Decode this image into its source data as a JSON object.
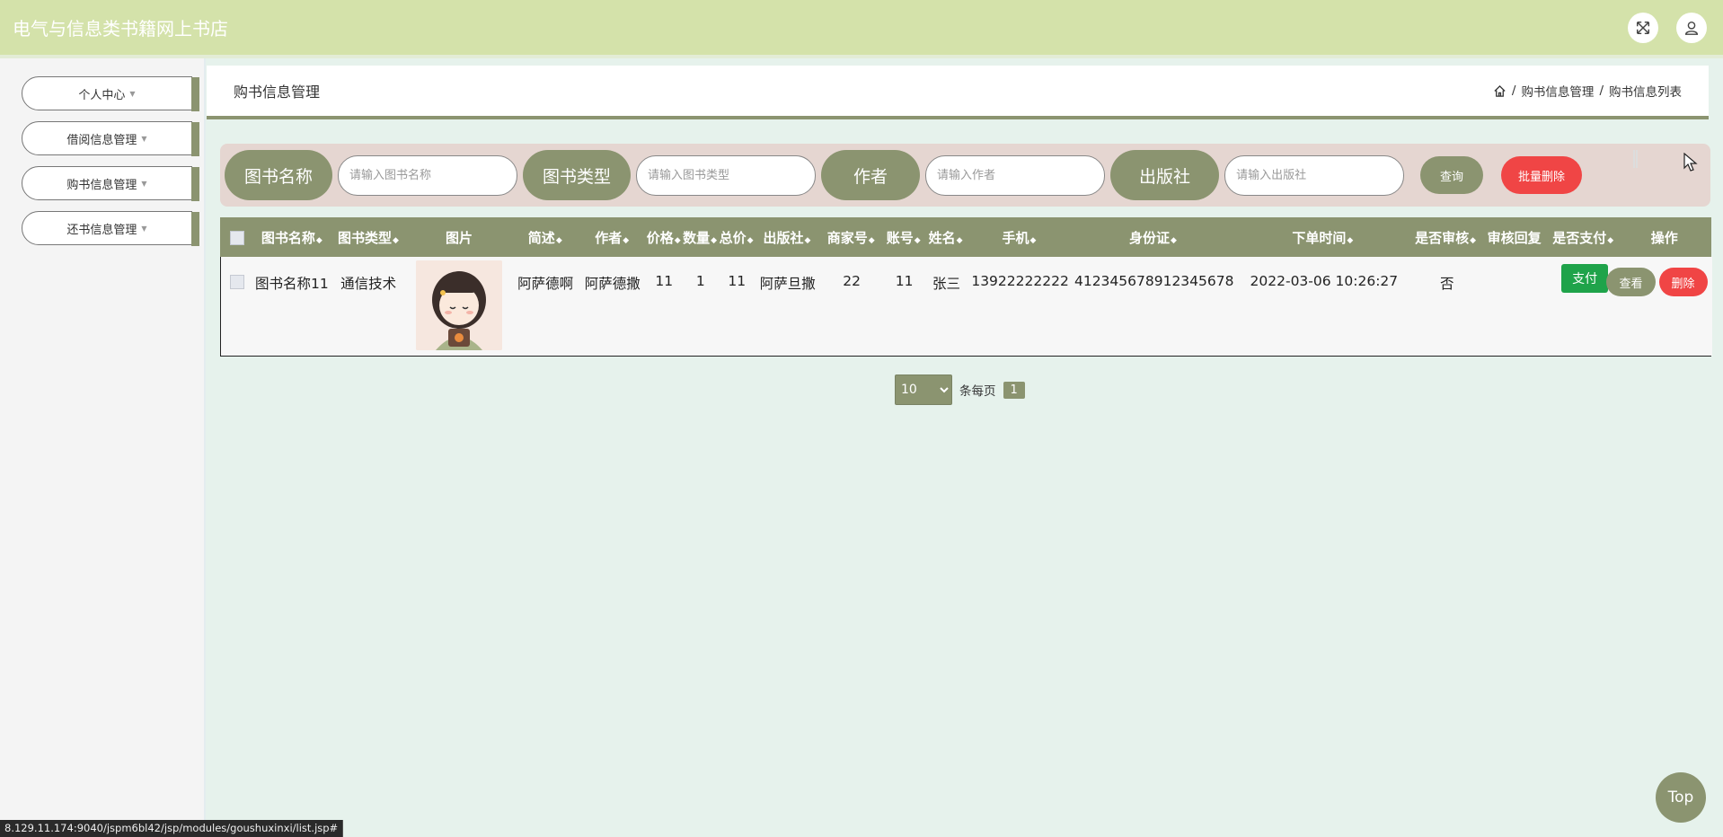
{
  "app": {
    "title": "电气与信息类书籍网上书店"
  },
  "topbar": {
    "fullscreen_icon": "expand-arrows-icon",
    "user_icon": "user-icon"
  },
  "sidebar": {
    "items": [
      {
        "label": "个人中心"
      },
      {
        "label": "借阅信息管理"
      },
      {
        "label": "购书信息管理"
      },
      {
        "label": "还书信息管理"
      }
    ]
  },
  "page": {
    "title": "购书信息管理",
    "breadcrumb": {
      "home_icon": "home-icon",
      "section": "购书信息管理",
      "current": "购书信息列表",
      "separator": "/"
    }
  },
  "search": {
    "fields": [
      {
        "label": "图书名称",
        "placeholder": "请输入图书名称"
      },
      {
        "label": "图书类型",
        "placeholder": "请输入图书类型"
      },
      {
        "label": "作者",
        "placeholder": "请输入作者"
      },
      {
        "label": "出版社",
        "placeholder": "请输入出版社"
      }
    ],
    "query_label": "查询",
    "batch_delete_label": "批量删除"
  },
  "table": {
    "columns": [
      "图书名称",
      "图书类型",
      "图片",
      "简述",
      "作者",
      "价格",
      "数量",
      "总价",
      "出版社",
      "商家号",
      "账号",
      "姓名",
      "手机",
      "身份证",
      "下单时间",
      "是否审核",
      "审核回复",
      "是否支付",
      "操作"
    ],
    "sort_glyph": "◆",
    "rows": [
      {
        "book_name": "图书名称11",
        "book_type": "通信技术",
        "summary": "阿萨德啊",
        "author": "阿萨德撒",
        "price": "11",
        "quantity": "1",
        "total": "11",
        "publisher": "阿萨旦撒",
        "merchant_no": "22",
        "account": "11",
        "name": "张三",
        "phone": "13922222222",
        "id_card": "412345678912345678",
        "order_time": "2022-03-06 10:26:27",
        "audited": "否",
        "audit_reply": "",
        "paid": "",
        "pay_label": "支付",
        "view_label": "查看",
        "delete_label": "删除"
      }
    ]
  },
  "pager": {
    "page_size": "10",
    "per_page_label": "条每页",
    "current_page": "1"
  },
  "top_button": {
    "label": "Top"
  },
  "status_bar": {
    "url": "8.129.11.174:9040/jspm6bl42/jsp/modules/goushuxinxi/list.jsp#"
  },
  "colors": {
    "accent": "#8b9470",
    "header": "#d4e2aa",
    "danger": "#f04545",
    "success": "#1fa34a",
    "search_bg": "#e5d6d1"
  }
}
